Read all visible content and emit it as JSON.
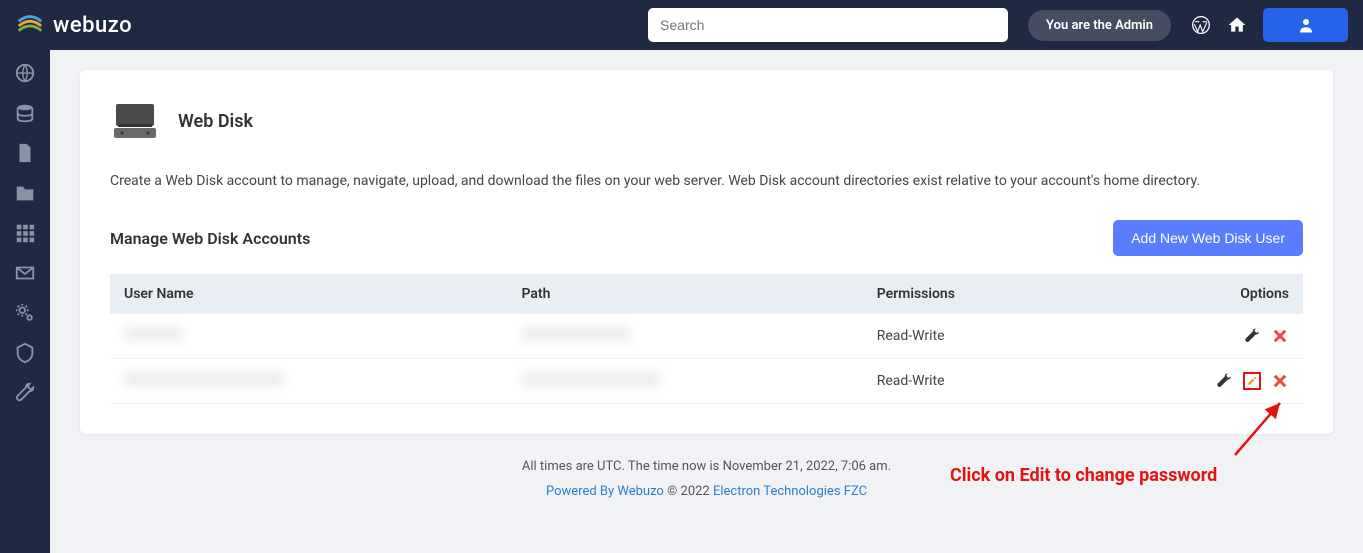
{
  "brand": {
    "name": "webuzo"
  },
  "header": {
    "search_placeholder": "Search",
    "admin_label": "You are the Admin"
  },
  "sidebar": {
    "items": [
      {
        "name": "globe"
      },
      {
        "name": "database"
      },
      {
        "name": "file"
      },
      {
        "name": "folder"
      },
      {
        "name": "grid"
      },
      {
        "name": "envelope"
      },
      {
        "name": "cogs"
      },
      {
        "name": "shield"
      },
      {
        "name": "wrench"
      }
    ]
  },
  "page": {
    "title": "Web Disk",
    "description": "Create a Web Disk account to manage, navigate, upload, and download the files on your web server. Web Disk account directories exist relative to your account's home directory."
  },
  "section": {
    "title": "Manage Web Disk Accounts",
    "add_button": "Add New Web Disk User"
  },
  "table": {
    "headers": {
      "username": "User Name",
      "path": "Path",
      "permissions": "Permissions",
      "options": "Options"
    },
    "rows": [
      {
        "username": "████",
        "path": "██████",
        "permissions": "Read-Write",
        "show_edit": false
      },
      {
        "username": "████████",
        "path": "██████",
        "permissions": "Read-Write",
        "show_edit": true,
        "highlight_edit": true
      }
    ]
  },
  "footer": {
    "time_text": "All times are UTC. The time now is November 21, 2022, 7:06 am.",
    "powered": "Powered By Webuzo",
    "mid": " © 2022 ",
    "company": "Electron Technologies FZC"
  },
  "annotation": {
    "text": "Click on Edit to change password"
  }
}
